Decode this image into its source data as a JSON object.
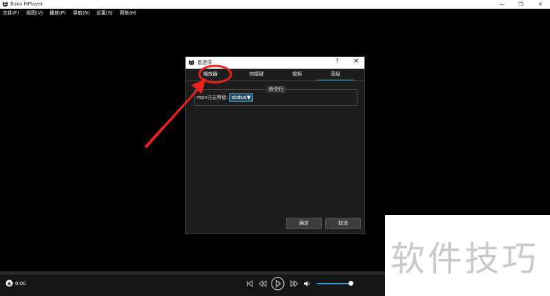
{
  "window": {
    "title": "Baka MPlayer",
    "minimize_glyph": "—",
    "maximize_glyph": "❐",
    "close_glyph": "✕"
  },
  "menu": {
    "items": [
      "文件(F)",
      "视图(V)",
      "播放(P)",
      "导航(N)",
      "设置(S)",
      "帮助(H)"
    ]
  },
  "dialog": {
    "title": "首选项",
    "help_glyph": "?",
    "close_glyph": "✕",
    "tabs": [
      {
        "label": "播放器"
      },
      {
        "label": "快捷键"
      },
      {
        "label": "视频"
      },
      {
        "label": "高级",
        "active": true
      }
    ],
    "group_title": "命令行",
    "log_level_label": "mpv日志等级:",
    "log_level_value": "status",
    "ok_label": "确定",
    "cancel_label": "取消"
  },
  "player": {
    "time": "0:00",
    "volume_fraction": 0.95
  },
  "watermark": {
    "text": "软件技巧"
  },
  "colors": {
    "accent": "#3fa0d8",
    "annotation_red": "#e8231e"
  },
  "icons": {
    "app": "cat-logo-icon",
    "eject": "eject-icon",
    "prev": "skip-previous-icon",
    "rewind": "rewind-icon",
    "play": "play-icon",
    "forward": "fast-forward-icon",
    "volume": "speaker-icon"
  }
}
